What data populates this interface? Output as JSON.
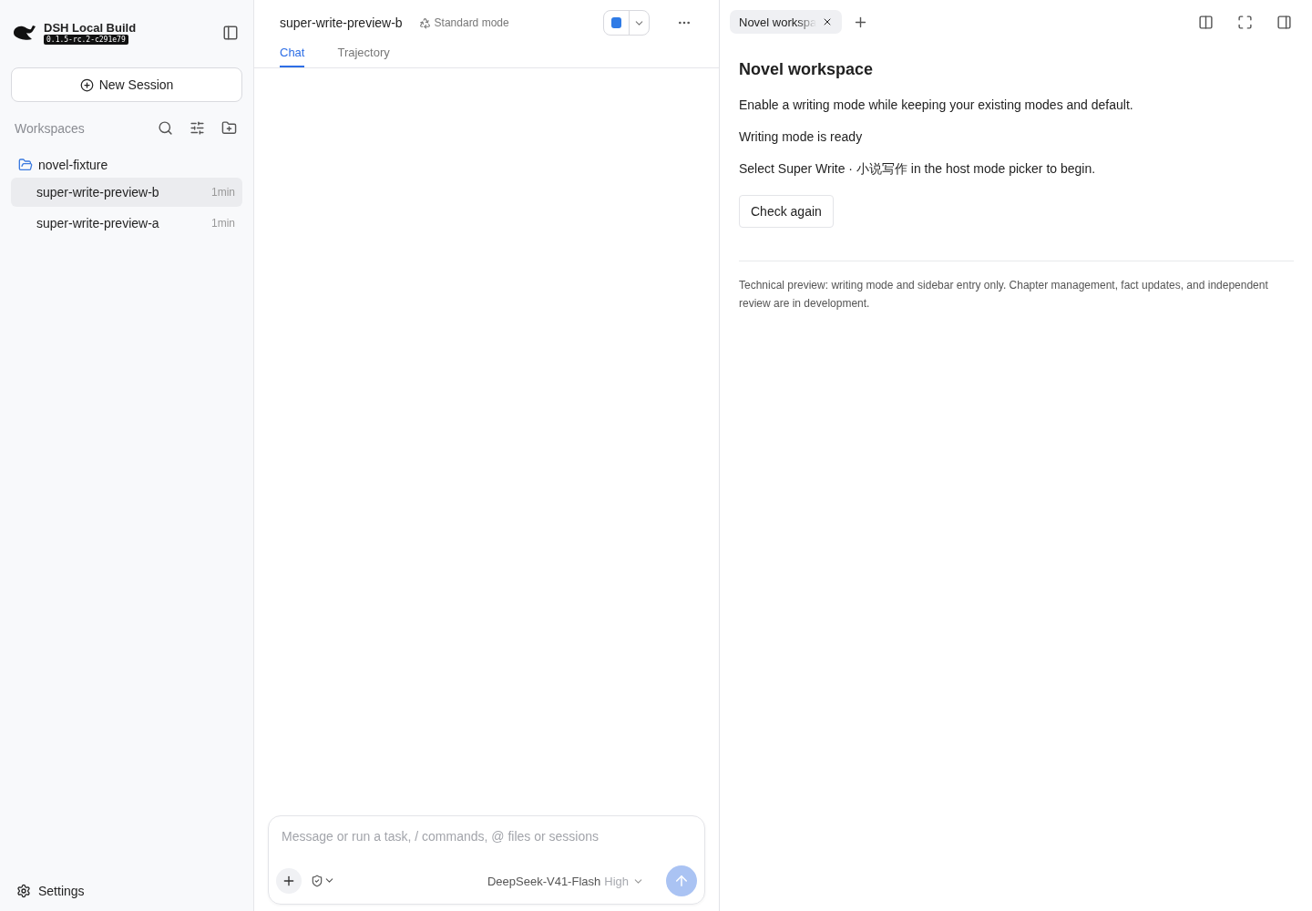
{
  "sidebar": {
    "app_name": "DSH Local Build",
    "version": "0.1.5-rc.2-c291e79",
    "new_session": "New Session",
    "workspaces_label": "Workspaces",
    "workspace": {
      "name": "novel-fixture",
      "expanded": true
    },
    "sessions": [
      {
        "name": "super-write-preview-b",
        "time": "1min",
        "selected": true
      },
      {
        "name": "super-write-preview-a",
        "time": "1min",
        "selected": false
      }
    ],
    "settings": "Settings"
  },
  "main": {
    "title": "super-write-preview-b",
    "mode": "Standard mode",
    "tabs": [
      {
        "label": "Chat",
        "selected": true
      },
      {
        "label": "Trajectory",
        "selected": false
      }
    ],
    "composer": {
      "placeholder": "Message or run a task, / commands, @ files or sessions",
      "model": "DeepSeek-V41-Flash",
      "effort": "High"
    }
  },
  "panel": {
    "tabs": [
      {
        "label": "Novel workspa",
        "selected": true
      }
    ],
    "heading": "Novel workspace",
    "intro": "Enable a writing mode while keeping your existing modes and default.",
    "status": "Writing mode is ready",
    "instruction": "Select Super Write · 小说写作 in the host mode picker to begin.",
    "button": "Check again",
    "note": "Technical preview: writing mode and sidebar entry only. Chapter management, fact updates, and independent review are in development."
  }
}
